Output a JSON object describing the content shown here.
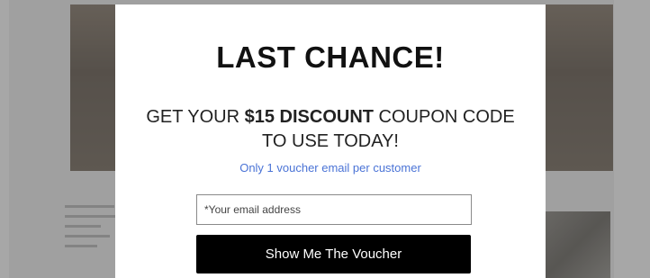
{
  "modal": {
    "title": "LAST CHANCE!",
    "subtitle_prefix": "GET YOUR ",
    "subtitle_bold": "$15 DISCOUNT",
    "subtitle_suffix": " COUPON CODE TO USE TODAY!",
    "note": "Only 1 voucher email per customer",
    "email_placeholder": "*Your email address",
    "button_label": "Show Me The Voucher"
  },
  "colors": {
    "note_text": "#4a73d6",
    "button_bg": "#000000",
    "overlay": "rgba(60,60,60,0.45)"
  }
}
